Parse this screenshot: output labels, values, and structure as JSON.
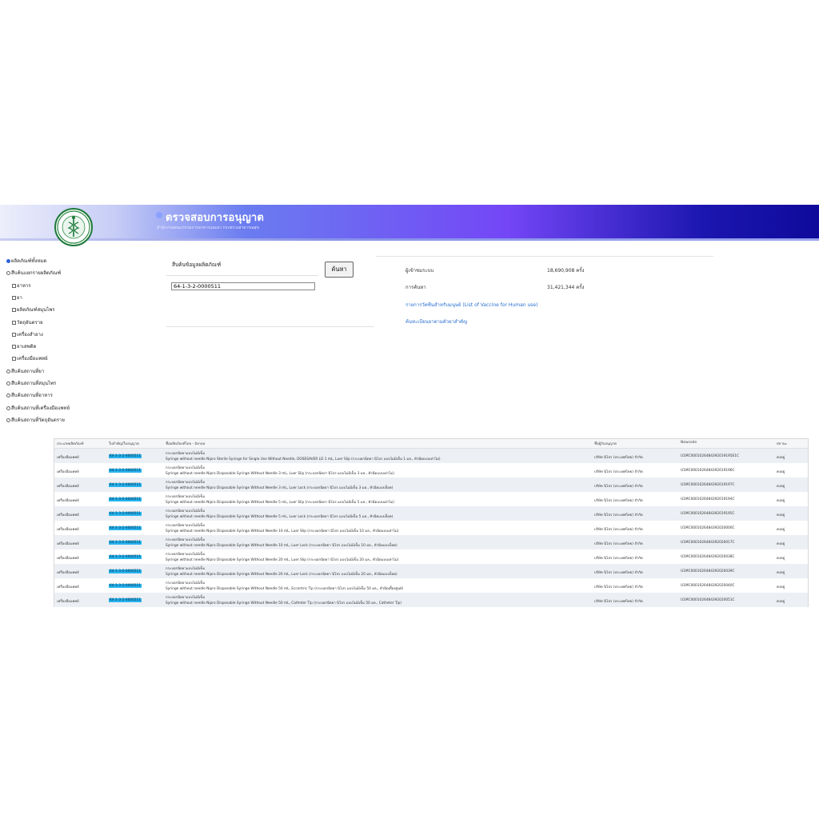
{
  "header": {
    "title": "ตรวจสอบการอนุญาต",
    "subtitle": "สำนักงานคณะกรรมการอาหารและยา กระทรวงสาธารณสุข",
    "colors": {
      "banner_start": "#c7cdf6",
      "banner_mid": "#7446f6",
      "banner_end": "#0f0a9a"
    }
  },
  "filters": {
    "items": [
      {
        "label": "ผลิตภัณฑ์ทั้งหมด",
        "type": "radio",
        "checked": true
      },
      {
        "label": "สืบค้นแยกรายผลิตภัณฑ์",
        "type": "radio",
        "checked": false
      },
      {
        "label": "อาหาร",
        "type": "checkbox",
        "checked": false
      },
      {
        "label": "ยา",
        "type": "checkbox",
        "checked": false
      },
      {
        "label": "ผลิตภัณฑ์สมุนไพร",
        "type": "checkbox",
        "checked": false
      },
      {
        "label": "วัตถุอันตราย",
        "type": "checkbox",
        "checked": false
      },
      {
        "label": "เครื่องสำอาง",
        "type": "checkbox",
        "checked": false
      },
      {
        "label": "ยาเสพติด",
        "type": "checkbox",
        "checked": false
      },
      {
        "label": "เครื่องมือแพทย์",
        "type": "checkbox",
        "checked": false
      },
      {
        "label": "สืบค้นสถานที่ยา",
        "type": "radio",
        "checked": false
      },
      {
        "label": "สืบค้นสถานที่สมุนไพร",
        "type": "radio",
        "checked": false
      },
      {
        "label": "สืบค้นสถานที่อาหาร",
        "type": "radio",
        "checked": false
      },
      {
        "label": "สืบค้นสถานที่เครื่องมือแพทย์",
        "type": "radio",
        "checked": false
      },
      {
        "label": "สืบค้นสถานที่วัตถุอันตราย",
        "type": "radio",
        "checked": false
      }
    ]
  },
  "search": {
    "label": "สืบค้นข้อมูลผลิตภัณฑ์",
    "value": "64-1-3-2-0000511",
    "button_label": "ค้นหา"
  },
  "stats": {
    "visitors_label": "ผู้เข้าชมระบบ",
    "visitors_value": "18,690,908 ครั้ง",
    "searches_label": "การค้นหา",
    "searches_value": "31,421,344 ครั้ง"
  },
  "links": {
    "vaccine": "รายการวัคซีนสำหรับมนุษย์ (List of Vaccine for Human use)",
    "ingredient": "ค้นทะเบียนยาตามตัวยาสำคัญ"
  },
  "table": {
    "headers": [
      "ประเภทผลิตภัณฑ์",
      "ใบสำคัญ/ใบอนุญาต",
      "ชื่อผลิตภัณฑ์ไทย - อังกฤษ",
      "ชื่อผู้รับอนุญาต",
      "Newcode",
      "สถานะ"
    ],
    "rows": [
      {
        "type": "เครื่องมือแพทย์",
        "license": "64-1-3-2-0000511",
        "name_th": "กระบอกฉีดยาแบบไม่มีเข็ม",
        "name_en": "Syringe without needle Nipro Sterile Syringe for Single Use Without Needle, DOSESAVER LD 1 mL, Luer Slip (กระบอกฉีดยา นิโปร แบบไม่มีเข็ม 1 มล., หัวฉีดแบบเท่าไม่)",
        "holder": "บริษัท นิโปร (ประเทศไทย) จำกัด",
        "newcode": "U1MC0001026484392019195E1C",
        "status": "คงอยู่"
      },
      {
        "type": "เครื่องมือแพทย์",
        "license": "64-1-3-2-0000511",
        "name_th": "กระบอกฉีดยาแบบไม่มีเข็ม",
        "name_en": "Syringe without needle Nipro Disposable Syringe Without Needle 3 mL, Luer Slip (กระบอกฉีดยา นิโปร แบบไม่มีเข็ม 3 มล., หัวฉีดแบบเท่าไม่)",
        "holder": "บริษัท นิโปร (ประเทศไทย) จำกัด",
        "newcode": "U1MC0001026484392019196C",
        "status": "คงอยู่"
      },
      {
        "type": "เครื่องมือแพทย์",
        "license": "64-1-3-2-0000511",
        "name_th": "กระบอกฉีดยาแบบไม่มีเข็ม",
        "name_en": "Syringe without needle Nipro Disposable Syringe Without Needle 3 mL, Luer Lock (กระบอกฉีดยา นิโปร แบบไม่มีเข็ม 3 มล., หัวฉีดแบบล็อค)",
        "holder": "บริษัท นิโปร (ประเทศไทย) จำกัด",
        "newcode": "U1MC0001026484392019197C",
        "status": "คงอยู่"
      },
      {
        "type": "เครื่องมือแพทย์",
        "license": "64-1-3-2-0000511",
        "name_th": "กระบอกฉีดยาแบบไม่มีเข็ม",
        "name_en": "Syringe without needle Nipro Disposable Syringe Without Needle 5 mL, Luer Slip (กระบอกฉีดยา นิโปร แบบไม่มีเข็ม 5 มล., หัวฉีดแบบเท่าไม่)",
        "holder": "บริษัท นิโปร (ประเทศไทย) จำกัด",
        "newcode": "U1MC0001026484392019194C",
        "status": "คงอยู่"
      },
      {
        "type": "เครื่องมือแพทย์",
        "license": "64-1-3-2-0000511",
        "name_th": "กระบอกฉีดยาแบบไม่มีเข็ม",
        "name_en": "Syringe without needle Nipro Disposable Syringe Without Needle 5 mL, Luer Lock (กระบอกฉีดยา นิโปร แบบไม่มีเข็ม 5 มล., หัวฉีดแบบล็อค)",
        "holder": "บริษัท นิโปร (ประเทศไทย) จำกัด",
        "newcode": "U1MC0001026484392019195C",
        "status": "คงอยู่"
      },
      {
        "type": "เครื่องมือแพทย์",
        "license": "64-1-3-2-0000511",
        "name_th": "กระบอกฉีดยาแบบไม่มีเข็ม",
        "name_en": "Syringe without needle Nipro Disposable Syringe Without Needle 10 mL, Luer Slip (กระบอกฉีดยา นิโปร แบบไม่มีเข็ม 10 มล., หัวฉีดแบบเท่าไม่)",
        "holder": "บริษัท นิโปร (ประเทศไทย) จำกัด",
        "newcode": "U1MC0001026484392020000C",
        "status": "คงอยู่"
      },
      {
        "type": "เครื่องมือแพทย์",
        "license": "64-1-3-2-0000511",
        "name_th": "กระบอกฉีดยาแบบไม่มีเข็ม",
        "name_en": "Syringe without needle Nipro Disposable Syringe Without Needle 10 mL, Luer Lock (กระบอกฉีดยา นิโปร แบบไม่มีเข็ม 10 มล., หัวฉีดแบบล็อค)",
        "holder": "บริษัท นิโปร (ประเทศไทย) จำกัด",
        "newcode": "U1MC0001026484392020017C",
        "status": "คงอยู่"
      },
      {
        "type": "เครื่องมือแพทย์",
        "license": "64-1-3-2-0000511",
        "name_th": "กระบอกฉีดยาแบบไม่มีเข็ม",
        "name_en": "Syringe without needle Nipro Disposable Syringe Without Needle 20 mL, Luer Slip (กระบอกฉีดยา นิโปร แบบไม่มีเข็ม 20 มล., หัวฉีดแบบเท่าไม่)",
        "holder": "บริษัท นิโปร (ประเทศไทย) จำกัด",
        "newcode": "U1MC0001026484392020038C",
        "status": "คงอยู่"
      },
      {
        "type": "เครื่องมือแพทย์",
        "license": "64-1-3-2-0000511",
        "name_th": "กระบอกฉีดยาแบบไม่มีเข็ม",
        "name_en": "Syringe without needle Nipro Disposable Syringe Without Needle 20 mL, Luer Lock (กระบอกฉีดยา นิโปร แบบไม่มีเข็ม 20 มล., หัวฉีดแบบล็อค)",
        "holder": "บริษัท นิโปร (ประเทศไทย) จำกัด",
        "newcode": "U1MC0001026484392020039C",
        "status": "คงอยู่"
      },
      {
        "type": "เครื่องมือแพทย์",
        "license": "64-1-3-2-0000511",
        "name_th": "กระบอกฉีดยาแบบไม่มีเข็ม",
        "name_en": "Syringe without needle Nipro Disposable Syringe Without Needle 50 mL, Eccentric Tip (กระบอกฉีดยา นิโปร แบบไม่มีเข็ม 50 มล., หัวฉีดเยื้องศูนย์)",
        "holder": "บริษัท นิโปร (ประเทศไทย) จำกัด",
        "newcode": "U1MC0001026484392020040C",
        "status": "คงอยู่"
      },
      {
        "type": "เครื่องมือแพทย์",
        "license": "64-1-3-2-0000511",
        "name_th": "กระบอกฉีดยาแบบไม่มีเข็ม",
        "name_en": "Syringe without needle Nipro Disposable Syringe Without Needle 50 mL, Catheter Tip (กระบอกฉีดยา นิโปร แบบไม่มีเข็ม 50 มล., Catheter Tip)",
        "holder": "บริษัท นิโปร (ประเทศไทย) จำกัด",
        "newcode": "U1MC0001026484392020051C",
        "status": "คงอยู่"
      }
    ]
  }
}
